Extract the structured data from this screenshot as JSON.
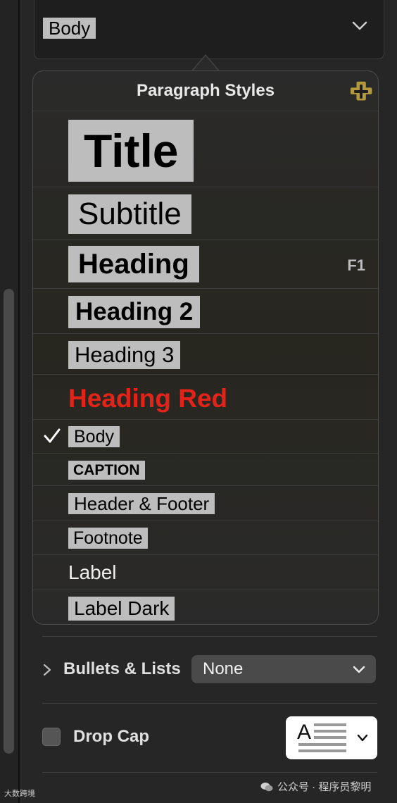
{
  "current_style": "Body",
  "popover": {
    "title": "Paragraph Styles",
    "styles": [
      {
        "label": "Title"
      },
      {
        "label": "Subtitle"
      },
      {
        "label": "Heading",
        "shortcut": "F1"
      },
      {
        "label": "Heading 2"
      },
      {
        "label": "Heading 3"
      },
      {
        "label": "Heading Red"
      },
      {
        "label": "Body",
        "selected": true
      },
      {
        "label": "CAPTION"
      },
      {
        "label": "Header & Footer"
      },
      {
        "label": "Footnote"
      },
      {
        "label": "Label"
      },
      {
        "label": "Label Dark"
      }
    ]
  },
  "bullets_lists": {
    "label": "Bullets & Lists",
    "value": "None"
  },
  "drop_cap": {
    "label": "Drop Cap",
    "checked": false
  },
  "watermark": {
    "left": "大数跨境",
    "right": "公众号 · 程序员黎明"
  },
  "colors": {
    "accent_add": "#b39a3a",
    "heading_red": "#e0241a",
    "chip_bg": "#bdbdbd"
  }
}
